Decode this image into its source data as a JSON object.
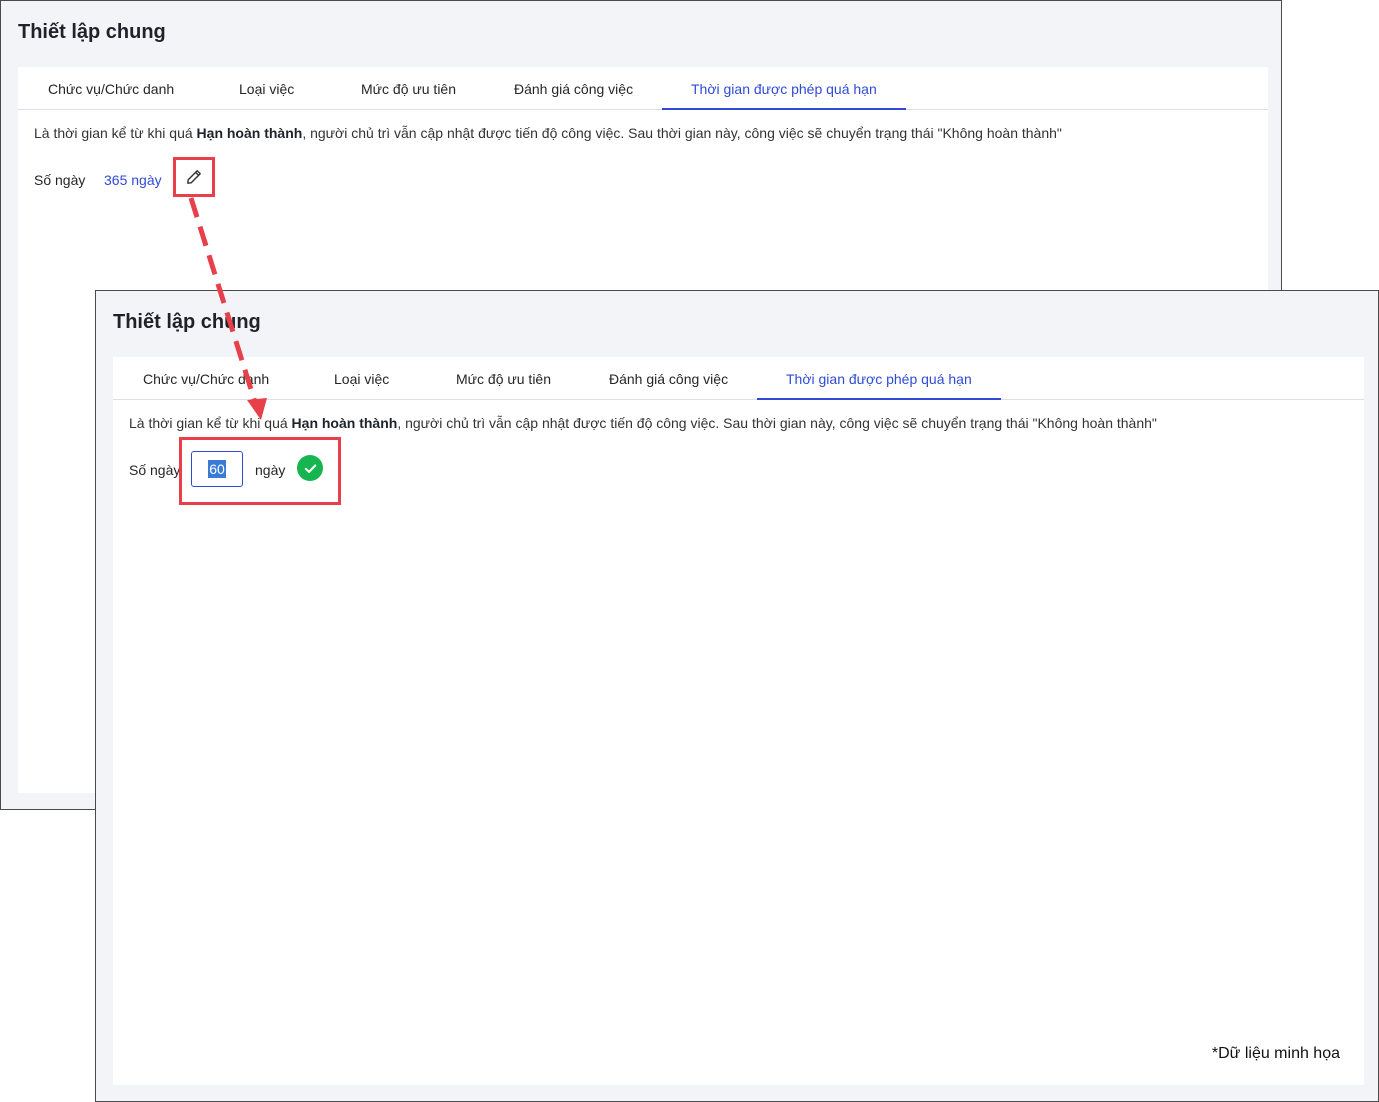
{
  "title": "Thiết lập chung",
  "tabs": [
    {
      "label": "Chức vụ/Chức danh"
    },
    {
      "label": "Loại việc"
    },
    {
      "label": "Mức độ ưu tiên"
    },
    {
      "label": "Đánh giá công việc"
    },
    {
      "label": "Thời gian được phép quá hạn",
      "active": true
    }
  ],
  "description": {
    "before": "Là thời gian kể từ khi quá ",
    "bold": "Hạn hoàn thành",
    "after": ", người chủ trì vẫn cập nhật được tiến độ công việc. Sau thời gian này, công việc sẽ chuyển trạng thái \"Không hoàn thành\""
  },
  "before": {
    "days_label": "Số ngày",
    "days_value": "365 ngày",
    "edit_icon": "pencil-icon"
  },
  "after": {
    "days_label": "Số ngày",
    "input_value": "60",
    "unit": "ngày",
    "confirm_icon": "check-circle-icon"
  },
  "note": "*Dữ liệu minh họa",
  "colors": {
    "accent": "#2f4bd6",
    "highlight": "#e8404a",
    "success": "#16b550",
    "background": "#f3f4f8"
  }
}
